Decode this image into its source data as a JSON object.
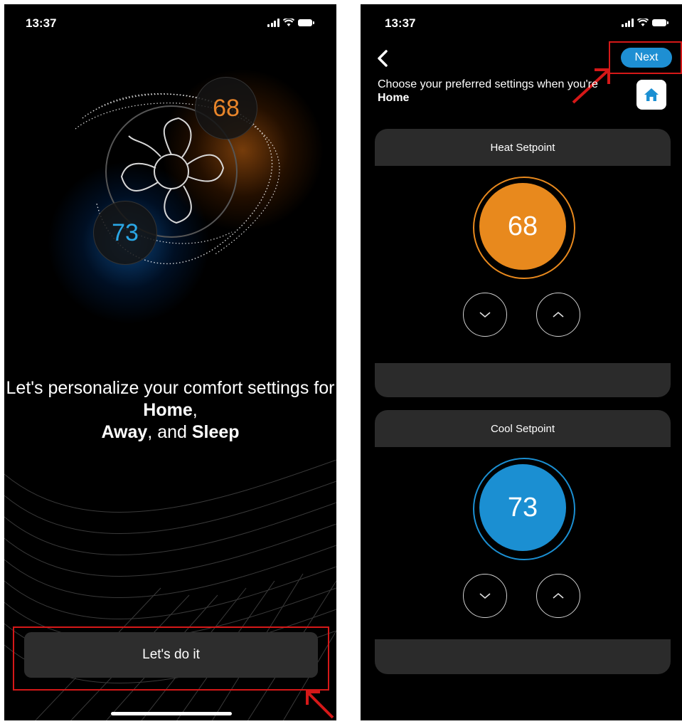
{
  "left_screen": {
    "status_time": "13:37",
    "hero_heat_value": "68",
    "hero_cool_value": "73",
    "intro": {
      "part1": "Let's personalize your comfort settings for ",
      "home": "Home",
      "comma": ",",
      "away": "Away",
      "and": ", and ",
      "sleep": "Sleep"
    },
    "cta_label": "Let's do it"
  },
  "right_screen": {
    "status_time": "13:37",
    "next_label": "Next",
    "prompt_prefix": "Choose your preferred settings when you're ",
    "prompt_mode": "Home",
    "heat": {
      "title": "Heat Setpoint",
      "value": "68"
    },
    "cool": {
      "title": "Cool Setpoint",
      "value": "73"
    }
  },
  "colors": {
    "heat": "#e8891d",
    "cool": "#1b8fd2",
    "highlight": "#d51818",
    "card": "#2b2b2b"
  },
  "icons": [
    "signal-icon",
    "wifi-icon",
    "battery-icon",
    "fan-icon",
    "back-chevron-icon",
    "home-icon",
    "chevron-down-icon",
    "chevron-up-icon",
    "red-arrow-icon"
  ]
}
